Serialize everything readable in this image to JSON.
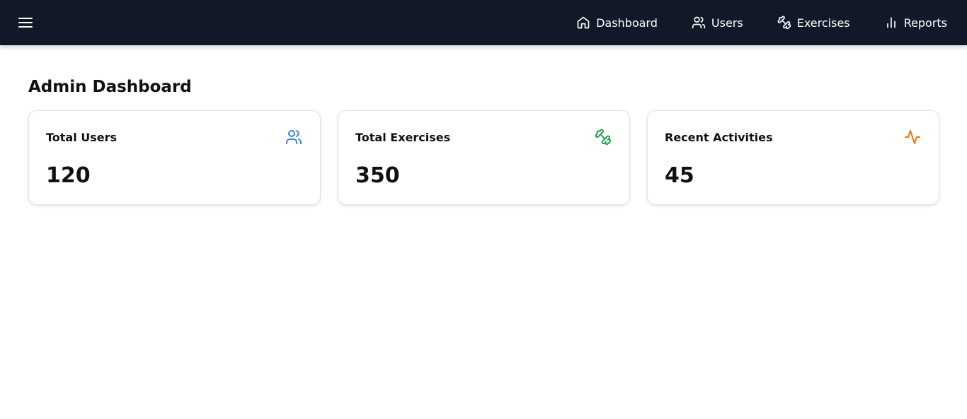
{
  "navbar": {
    "background": "#111827",
    "menu_icon": "hamburger-menu-icon",
    "links": [
      {
        "label": "Dashboard",
        "icon": "home-icon"
      },
      {
        "label": "Users",
        "icon": "users-icon"
      },
      {
        "label": "Exercises",
        "icon": "dumbbell-icon"
      },
      {
        "label": "Reports",
        "icon": "bar-chart-icon"
      }
    ]
  },
  "page": {
    "title": "Admin Dashboard"
  },
  "cards": [
    {
      "title": "Total Users",
      "value": "120",
      "icon": "users-icon",
      "icon_color": "#3b82f6"
    },
    {
      "title": "Total Exercises",
      "value": "350",
      "icon": "dumbbell-icon",
      "icon_color": "#16a34a"
    },
    {
      "title": "Recent Activities",
      "value": "45",
      "icon": "activity-icon",
      "icon_color": "#f97316"
    }
  ]
}
